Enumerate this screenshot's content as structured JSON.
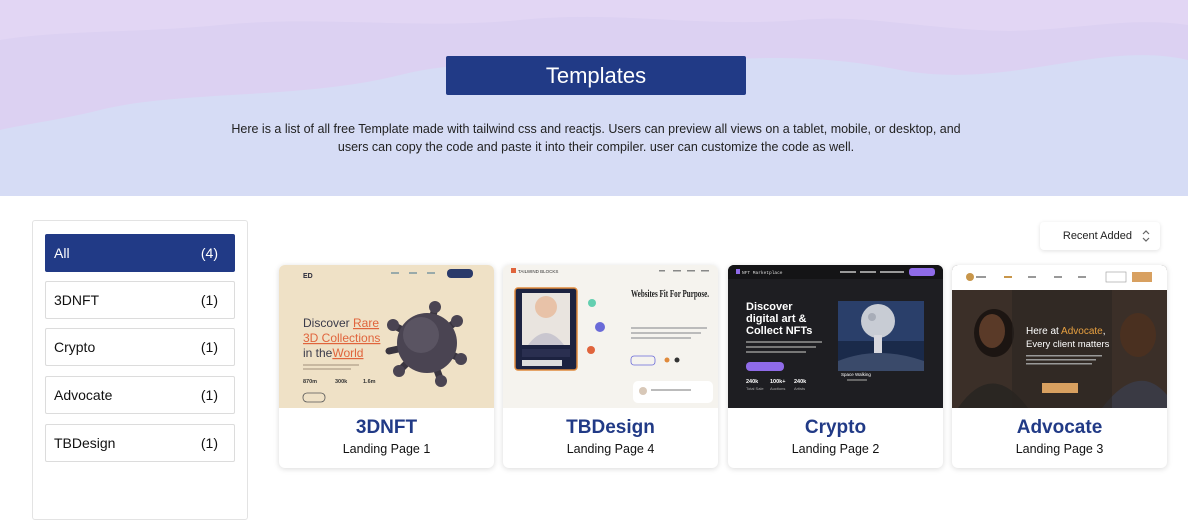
{
  "hero": {
    "title": "Templates",
    "description": "Here is a list of all free Template made with tailwind css and reactjs. Users can preview all views on a tablet, mobile, or desktop, and users can copy the code and paste it into their compiler. user can customize the code as well."
  },
  "sidebar": {
    "categories": [
      {
        "label": "All",
        "count": "(4)"
      },
      {
        "label": "3DNFT",
        "count": "(1)"
      },
      {
        "label": "Crypto",
        "count": "(1)"
      },
      {
        "label": "Advocate",
        "count": "(1)"
      },
      {
        "label": "TBDesign",
        "count": "(1)"
      }
    ]
  },
  "sort": {
    "label": "Recent Added"
  },
  "cards": [
    {
      "title": "3DNFT",
      "subtitle": "Landing Page 1",
      "thumb": {
        "logo": "ED",
        "headline_1": "Discover ",
        "headline_accent_1": "Rare",
        "headline_accent_2": "3D Collections",
        "headline_2": "in the",
        "headline_accent_3": "World",
        "stats": [
          "870m",
          "300k",
          "1.6m"
        ]
      }
    },
    {
      "title": "TBDesign",
      "subtitle": "Landing Page 4",
      "thumb": {
        "brand": "TAILWIND BLOCKS",
        "headline": "Websites Fit For Purpose."
      }
    },
    {
      "title": "Crypto",
      "subtitle": "Landing Page 2",
      "thumb": {
        "brand": "NFT Marketplace",
        "headline": "Discover digital art & Collect NFTs",
        "stats": [
          "240k",
          "100k+",
          "240k"
        ],
        "stat_labels": [
          "Total Sale",
          "Auctions",
          "Artists"
        ],
        "art_caption": "Space Walking"
      }
    },
    {
      "title": "Advocate",
      "subtitle": "Landing Page 3",
      "thumb": {
        "headline_1": "Here at ",
        "headline_accent": "Advocate",
        "headline_2": "Every client matters"
      }
    }
  ],
  "colors": {
    "primary": "#213a86",
    "hero_bg": "#d6dcf5",
    "wave": "#dcd1f2",
    "accent_orange": "#e0643c",
    "accent_purple": "#8f6be8"
  }
}
